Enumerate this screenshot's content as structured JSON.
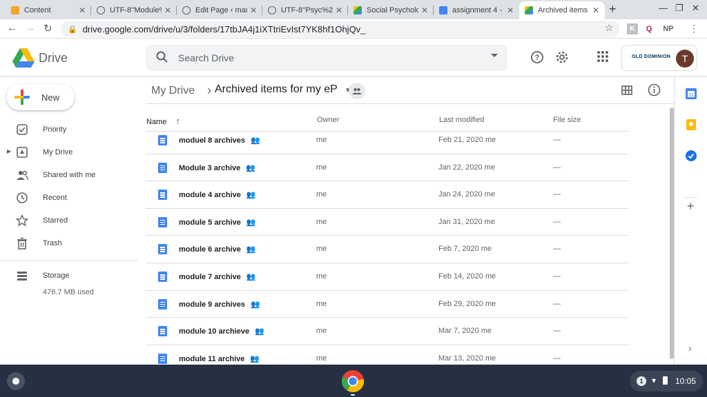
{
  "browser": {
    "tabs": [
      {
        "title": "Content",
        "favicon_color": "#f5a623"
      },
      {
        "title": "UTF-8''Module%",
        "favicon_color": "#5f6368"
      },
      {
        "title": "Edit Page ‹ mar",
        "favicon_color": "#5f6368"
      },
      {
        "title": "UTF-8''Psyc%20",
        "favicon_color": "#5f6368"
      },
      {
        "title": "Social Psycholo",
        "favicon_color": "#34a853"
      },
      {
        "title": "assignment 4 - (",
        "favicon_color": "#4285f4"
      },
      {
        "title": "Archived items f",
        "favicon_color": "#34a853"
      }
    ],
    "url": "drive.google.com/drive/u/3/folders/17tbJA4j1iXTtriEvIst7YK8hf1OhjQv_",
    "extensions": [
      "NP"
    ]
  },
  "drive": {
    "logo_text": "Drive",
    "search_placeholder": "Search Drive",
    "org_name": "OLD DOMINION",
    "avatar_letter": "T",
    "new_button": "New",
    "nav": [
      {
        "label": "Priority",
        "icon": "priority-icon"
      },
      {
        "label": "My Drive",
        "icon": "my-drive-icon"
      },
      {
        "label": "Shared with me",
        "icon": "shared-with-me-icon"
      },
      {
        "label": "Recent",
        "icon": "recent-icon"
      },
      {
        "label": "Starred",
        "icon": "star-icon"
      },
      {
        "label": "Trash",
        "icon": "trash-icon"
      }
    ],
    "storage": {
      "label": "Storage",
      "used": "476.7 MB used"
    },
    "breadcrumb": {
      "root": "My Drive",
      "current": "Archived items for my eP"
    },
    "columns": {
      "name": "Name",
      "owner": "Owner",
      "modified": "Last modified",
      "size": "File size"
    },
    "files": [
      {
        "name": "moduel 8 archives",
        "owner": "me",
        "modified": "Feb 21, 2020  me",
        "size": "—"
      },
      {
        "name": "Module 3 archive",
        "owner": "me",
        "modified": "Jan 22, 2020  me",
        "size": "—"
      },
      {
        "name": "module 4 archive",
        "owner": "me",
        "modified": "Jan 24, 2020  me",
        "size": "—"
      },
      {
        "name": "module 5 archive",
        "owner": "me",
        "modified": "Jan 31, 2020  me",
        "size": "—"
      },
      {
        "name": "module 6 archive",
        "owner": "me",
        "modified": "Feb 7, 2020  me",
        "size": "—"
      },
      {
        "name": "module 7 archive",
        "owner": "me",
        "modified": "Feb 14, 2020  me",
        "size": "—"
      },
      {
        "name": "module 9 archives",
        "owner": "me",
        "modified": "Feb 29, 2020  me",
        "size": "—"
      },
      {
        "name": "module 10 archieve",
        "owner": "me",
        "modified": "Mar 7, 2020  me",
        "size": "—"
      },
      {
        "name": "module 11 archive",
        "owner": "me",
        "modified": "Mar 13, 2020  me",
        "size": "—"
      }
    ]
  },
  "shelf": {
    "time": "10:05",
    "notification_count": "1"
  },
  "colors": {
    "accent": "#1a73e8",
    "shelf": "#263042"
  }
}
